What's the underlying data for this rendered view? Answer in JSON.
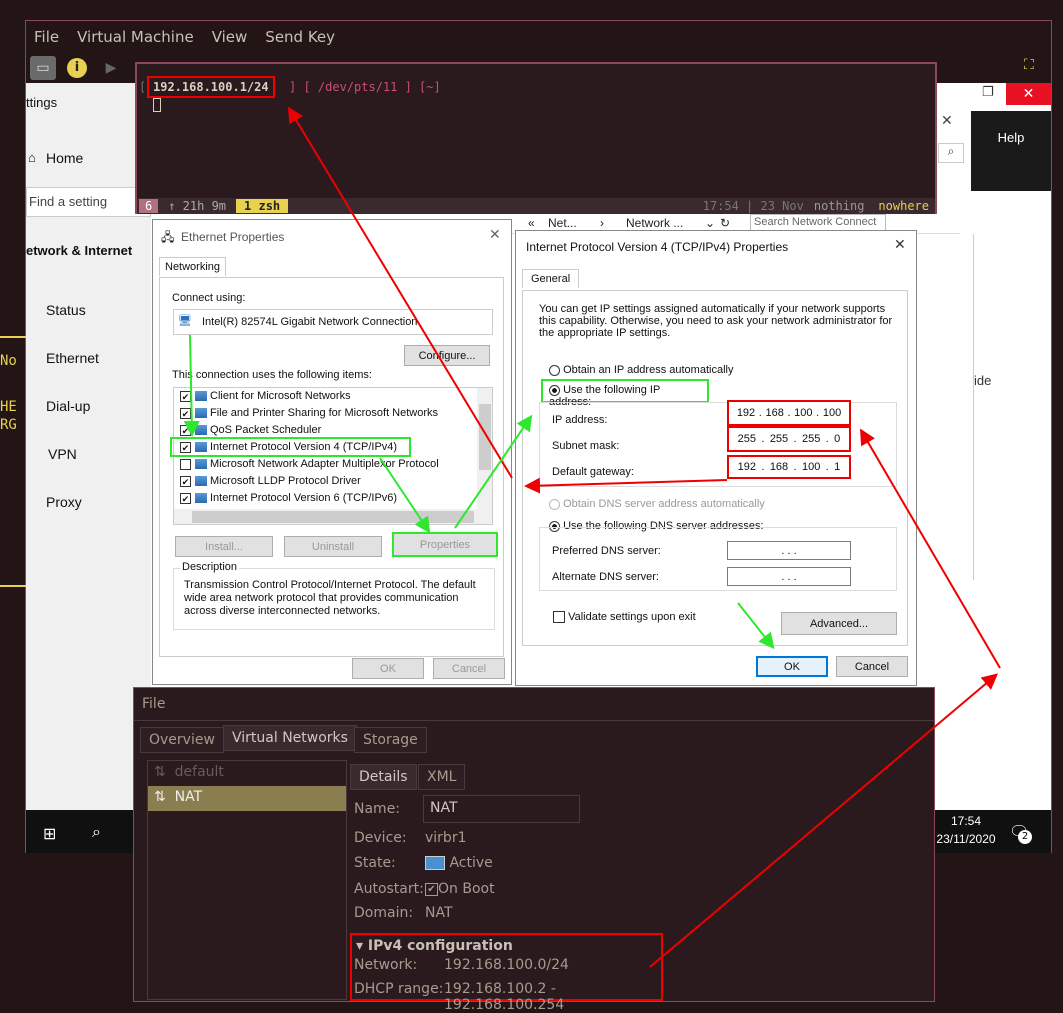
{
  "vm_window": {
    "menu": [
      "File",
      "Virtual Machine",
      "View",
      "Send Key"
    ]
  },
  "settings": {
    "title": "ttings",
    "home": "Home",
    "find": "Find a setting",
    "section": "etwork & Internet",
    "items": [
      "Status",
      "Ethernet",
      "Dial-up",
      "VPN",
      "Proxy"
    ],
    "help": "Help",
    "right_text": "ide"
  },
  "left_glimpse": [
    "No",
    "HE",
    "RG"
  ],
  "terminal": {
    "ip": "192.168.100.1/24",
    "rest": "] [ /dev/pts/11 ] [~]",
    "open_bracket": "[",
    "status_win": "6",
    "status_up": "↑ 21h 9m",
    "status_tab": "1 zsh",
    "status_time": "17:54 | 23 Nov",
    "status_host1": "nothing",
    "status_host2": "nowhere"
  },
  "ethernet": {
    "title": "Ethernet Properties",
    "tab": "Networking",
    "connect_using": "Connect using:",
    "adapter": "Intel(R) 82574L Gigabit Network Connection",
    "configure": "Configure...",
    "items_label": "This connection uses the following items:",
    "items": [
      {
        "label": "Client for Microsoft Networks",
        "checked": true
      },
      {
        "label": "File and Printer Sharing for Microsoft Networks",
        "checked": true
      },
      {
        "label": "QoS Packet Scheduler",
        "checked": true
      },
      {
        "label": "Internet Protocol Version 4 (TCP/IPv4)",
        "checked": true
      },
      {
        "label": "Microsoft Network Adapter Multiplexor Protocol",
        "checked": false
      },
      {
        "label": "Microsoft LLDP Protocol Driver",
        "checked": true
      },
      {
        "label": "Internet Protocol Version 6 (TCP/IPv6)",
        "checked": true
      }
    ],
    "install": "Install...",
    "uninstall": "Uninstall",
    "properties": "Properties",
    "desc_title": "Description",
    "desc": "Transmission Control Protocol/Internet Protocol. The default wide area network protocol that provides communication across diverse interconnected networks.",
    "ok": "OK",
    "cancel": "Cancel"
  },
  "explorer": {
    "crumb1": "Net...",
    "crumb2": "Network ...",
    "search": "Search Network Connect"
  },
  "ipv4": {
    "title": "Internet Protocol Version 4 (TCP/IPv4) Properties",
    "tab": "General",
    "intro": "You can get IP settings assigned automatically if your network supports this capability. Otherwise, you need to ask your network administrator for the appropriate IP settings.",
    "auto_ip": "Obtain an IP address automatically",
    "use_ip": "Use the following IP address:",
    "ip_label": "IP address:",
    "ip": [
      "192",
      "168",
      "100",
      "100"
    ],
    "mask_label": "Subnet mask:",
    "mask": [
      "255",
      "255",
      "255",
      "0"
    ],
    "gw_label": "Default gateway:",
    "gw": [
      "192",
      "168",
      "100",
      "1"
    ],
    "auto_dns": "Obtain DNS server address automatically",
    "use_dns": "Use the following DNS server addresses:",
    "pref_dns": "Preferred DNS server:",
    "alt_dns": "Alternate DNS server:",
    "dots": ".   .   .",
    "validate": "Validate settings upon exit",
    "advanced": "Advanced...",
    "ok": "OK",
    "cancel": "Cancel"
  },
  "clock": {
    "time": "17:54",
    "date": "23/11/2020",
    "notif": "2"
  },
  "vnm": {
    "menu": "File",
    "tabs": [
      "Overview",
      "Virtual Networks",
      "Storage"
    ],
    "networks": [
      "default",
      "NAT"
    ],
    "subtabs": [
      "Details",
      "XML"
    ],
    "name_label": "Name:",
    "name": "NAT",
    "device_label": "Device:",
    "device": "virbr1",
    "state_label": "State:",
    "state": "Active",
    "autostart_label": "Autostart:",
    "autostart": "On Boot",
    "domain_label": "Domain:",
    "domain": "NAT",
    "ipv4_title": "IPv4 configuration",
    "network_label": "Network:",
    "network": "192.168.100.0/24",
    "dhcp_label": "DHCP range:",
    "dhcp": "192.168.100.2 - 192.168.100.254"
  },
  "colors": {
    "red": "#e00000",
    "green": "#2ee82e",
    "term_bg": "#2a1a1e"
  }
}
